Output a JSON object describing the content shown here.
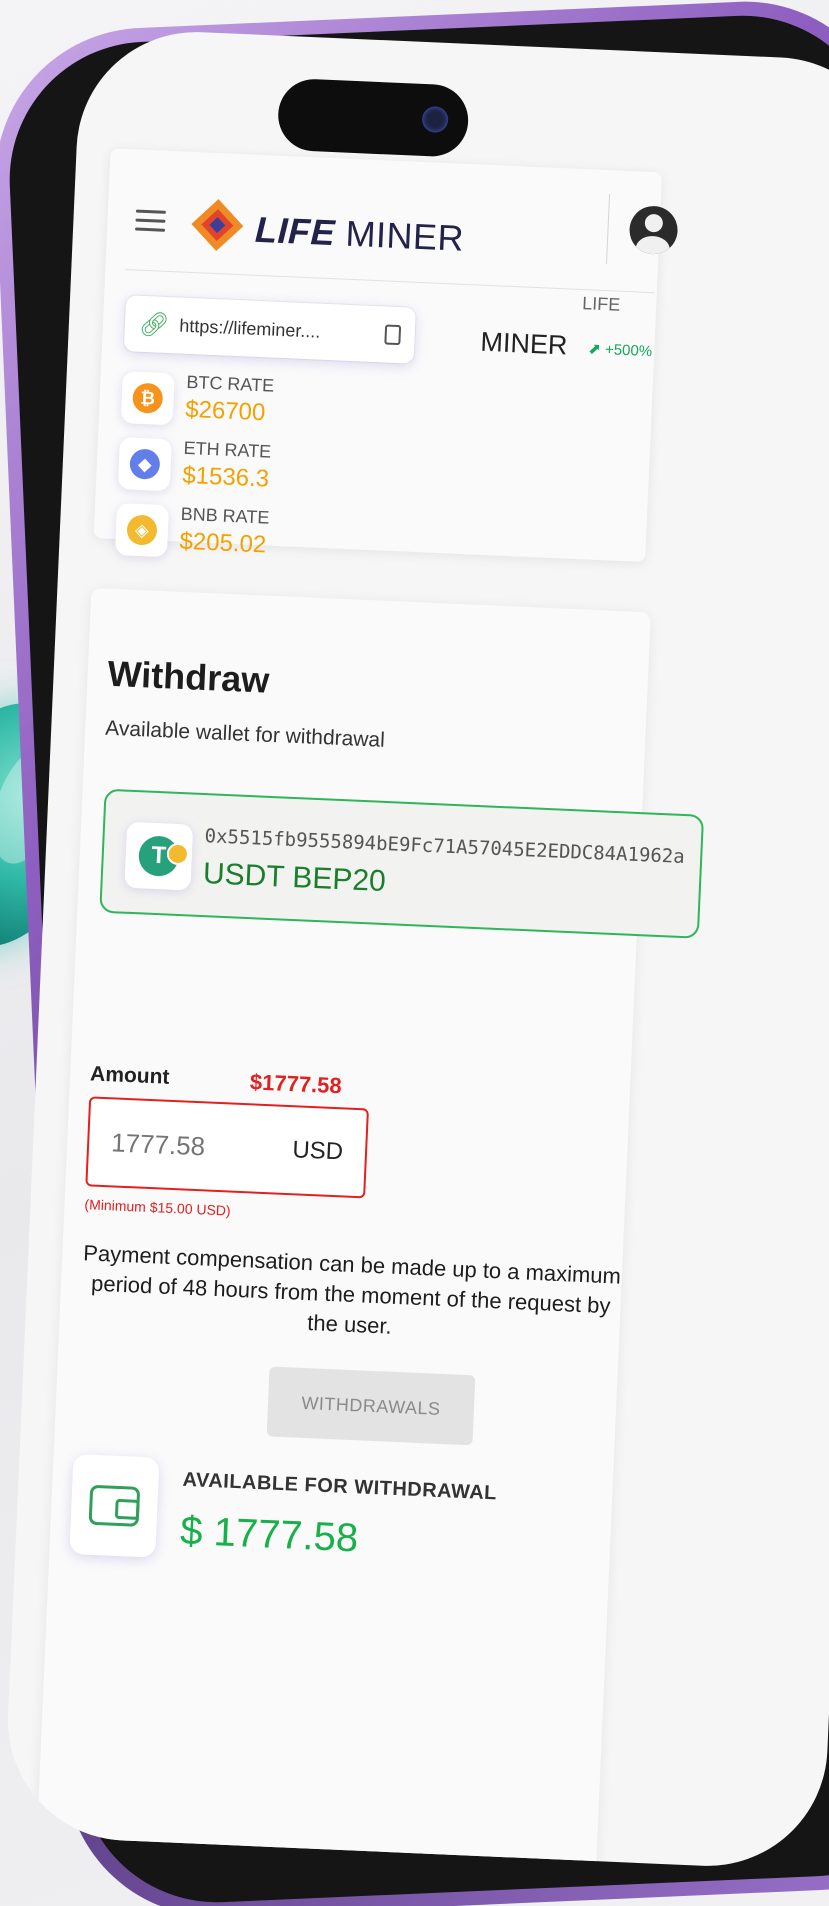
{
  "header": {
    "logo_bold": "LIFE",
    "logo_light": " MINER"
  },
  "referral": {
    "url": "https://lifeminer...."
  },
  "ticker": {
    "small": "LIFE",
    "name": "MINER",
    "change": "⬈ +500%"
  },
  "rates": [
    {
      "label": "BTC RATE",
      "value": "$26700",
      "symbol": "₿",
      "color": "#f7931a"
    },
    {
      "label": "ETH RATE",
      "value": "$1536.3",
      "symbol": "◆",
      "color": "#627eea"
    },
    {
      "label": "BNB RATE",
      "value": "$205.02",
      "symbol": "◈",
      "color": "#f3ba2f"
    }
  ],
  "withdraw": {
    "title": "Withdraw",
    "subtitle": "Available wallet for withdrawal",
    "wallet_address": "0x5515fb9555894bE9Fc71A57045E2EDDC84A1962a",
    "wallet_network": "USDT BEP20",
    "amount_label": "Amount",
    "amount_balance": "$1777.58",
    "amount_placeholder": "1777.58",
    "amount_unit": "USD",
    "amount_minimum": "(Minimum $15.00 USD)",
    "notice": "Payment compensation can be made up to a maximum period of 48 hours from the moment of the request by the user.",
    "button_label": "WITHDRAWALS",
    "available_label": "AVAILABLE FOR WITHDRAWAL",
    "available_value": "$ 1777.58"
  },
  "colors": {
    "accent_green": "#2fb55a",
    "error_red": "#e32020",
    "rate_orange": "#f4a100",
    "phone_purple": "#8e5fc0"
  }
}
